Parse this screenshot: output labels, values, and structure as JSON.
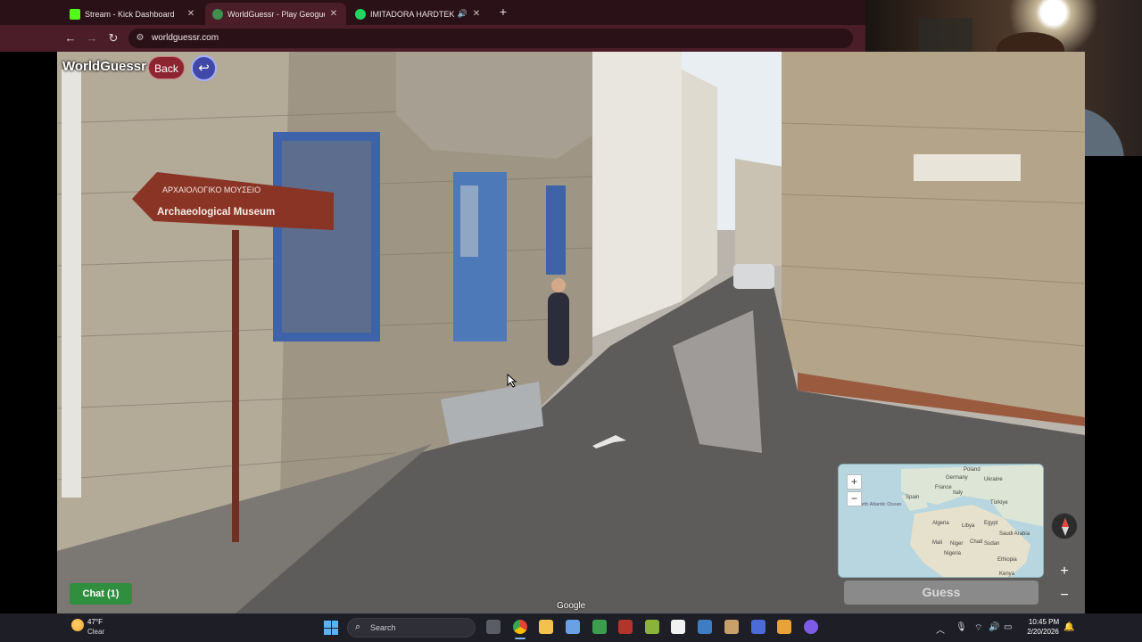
{
  "browser": {
    "tabs": [
      {
        "title": "Stream - Kick Dashboard",
        "favicon": "kick-icon",
        "color": "#53fc18",
        "active": false
      },
      {
        "title": "WorldGuessr - Play Geoguessr",
        "favicon": "worldguessr-icon",
        "color": "#3f8f4f",
        "active": true
      },
      {
        "title": "IMITADORA HARDTEKK - U",
        "favicon": "spotify-icon",
        "color": "#1ed760",
        "active": false
      }
    ],
    "url": "worldguessr.com",
    "accent": "#4a1d28"
  },
  "game": {
    "logo": "WorldGuessr",
    "back_label": "Back",
    "sign_top": "ΑΡΧΑΙΟΛΟΓΙΚΟ ΜΟΥΣΕΙΟ",
    "sign_text": "Archaeological Museum",
    "chat_label": "Chat (1)",
    "guess_label": "Guess",
    "attribution": "Google",
    "map_labels": {
      "poland": "Poland",
      "germany": "Germany",
      "ukraine": "Ukraine",
      "france": "France",
      "spain": "Spain",
      "italy": "Italy",
      "turkey": "Türkiye",
      "north_atlantic": "North Atlantic Ocean",
      "algeria": "Algeria",
      "libya": "Libya",
      "egypt": "Egypt",
      "saudi_arabia": "Saudi Arabia",
      "mali": "Mali",
      "niger": "Niger",
      "chad": "Chad",
      "sudan": "Sudan",
      "nigeria": "Nigeria",
      "ethiopia": "Ethiopia",
      "kenya": "Kenya"
    }
  },
  "taskbar": {
    "weather_temp": "47°F",
    "weather_desc": "Clear",
    "search_placeholder": "Search",
    "time": "10:45 PM",
    "date": "2/20/2026"
  }
}
